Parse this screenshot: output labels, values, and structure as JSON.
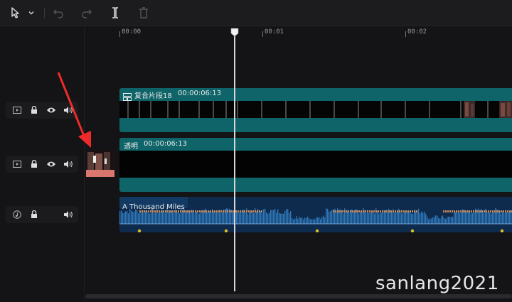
{
  "toolbar": {
    "tools": [
      "select-tool",
      "undo",
      "redo",
      "split",
      "delete"
    ]
  },
  "ruler": {
    "labels": [
      "00:00",
      "00:01",
      "00:02"
    ]
  },
  "tracks": {
    "compound": {
      "name": "复合片段18",
      "duration": "00:00:06:13",
      "color": "#0f6a6e"
    },
    "video": {
      "name": "透明",
      "duration": "00:00:06:13",
      "color": "#0f6a6e"
    },
    "audio": {
      "name": "A Thousand Miles",
      "color": "#1d4f7e"
    }
  },
  "watermark": "sanlang2021"
}
